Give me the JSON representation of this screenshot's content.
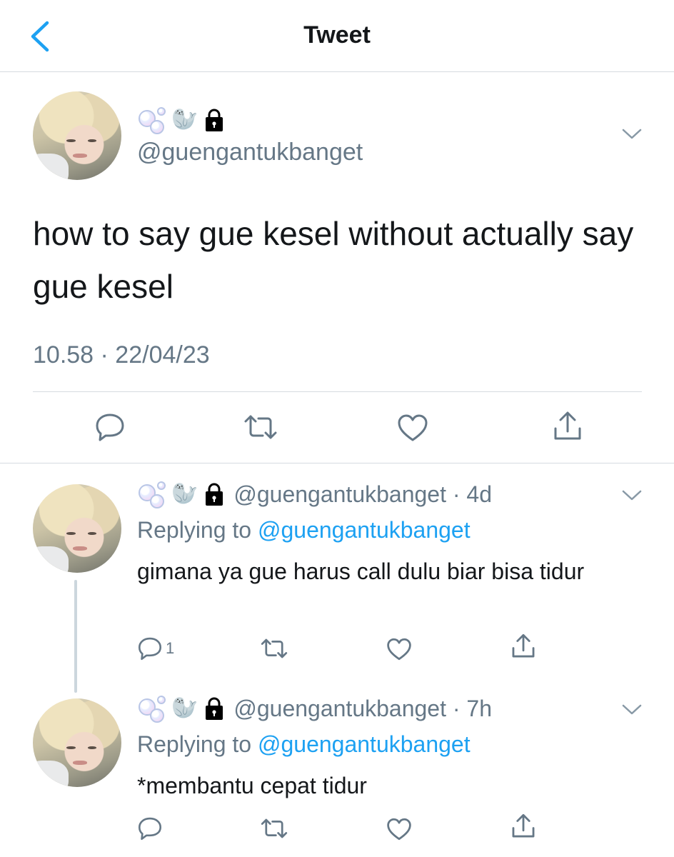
{
  "header": {
    "title": "Tweet",
    "back_icon": "chevron-left-icon"
  },
  "tweet": {
    "display_name_icons": [
      "bubbles-emoji",
      "seal-emoji",
      "lock-icon"
    ],
    "handle": "@guengantukbanget",
    "text": "how to say gue kesel without actually say gue kesel",
    "timestamp": "10.58 · 22/04/23",
    "actions": [
      "reply-icon",
      "retweet-icon",
      "like-icon",
      "share-icon"
    ]
  },
  "replies": [
    {
      "handle_time": "@guengantukbanget · 4d",
      "replying_prefix": "Replying to ",
      "replying_to": "@guengantukbanget",
      "text": "gimana ya gue harus call dulu biar bisa tidur",
      "reply_count": "1"
    },
    {
      "handle_time": "@guengantukbanget · 7h",
      "replying_prefix": "Replying to ",
      "replying_to": "@guengantukbanget",
      "text": "*membantu cepat tidur",
      "reply_count": ""
    }
  ],
  "colors": {
    "accent": "#1da1f2",
    "secondary_text": "#657786",
    "divider": "#d6dbe0"
  }
}
